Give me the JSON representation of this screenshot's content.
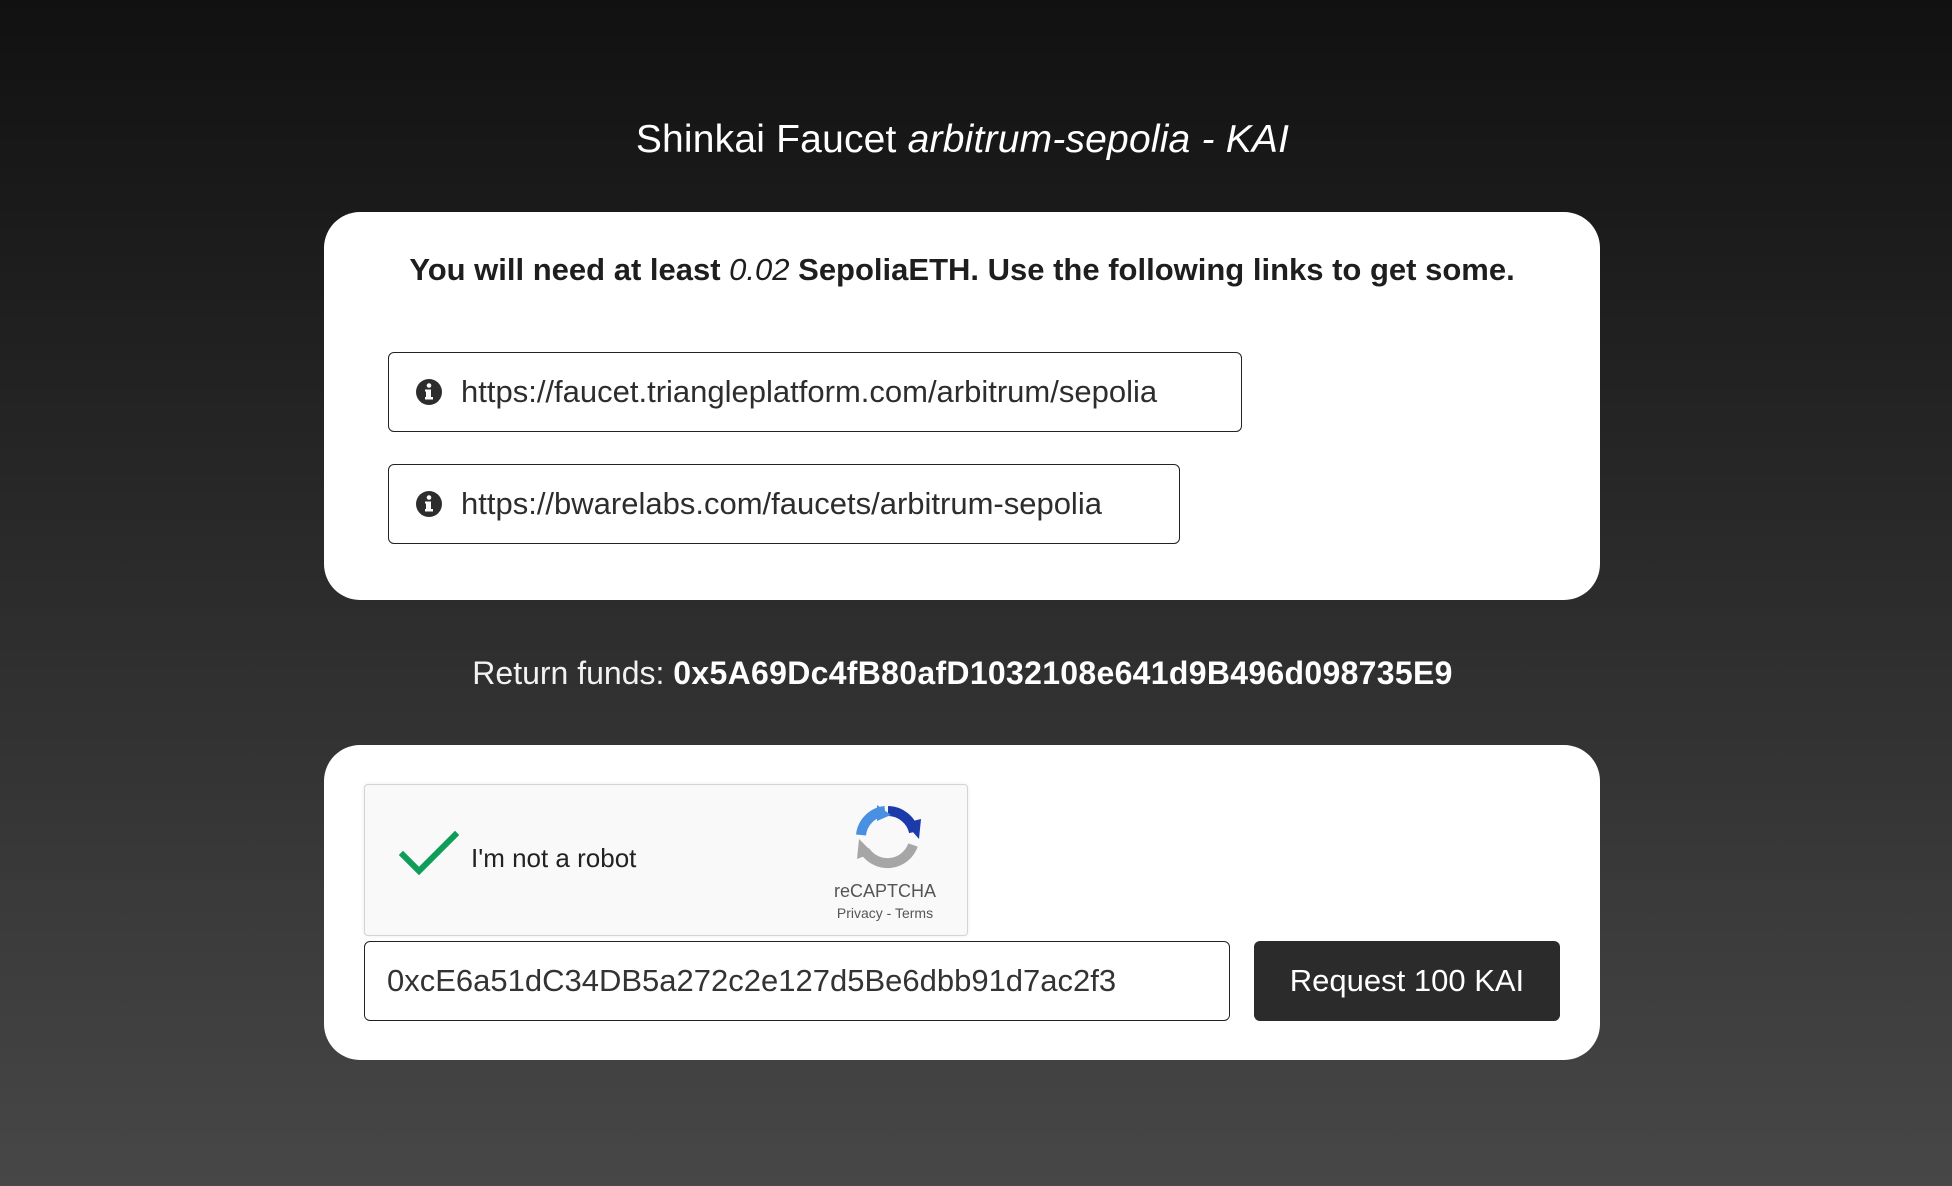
{
  "header": {
    "title_prefix": "Shinkai Faucet",
    "title_network": "arbitrum-sepolia - KAI"
  },
  "requirements": {
    "text_before": "You will need at least",
    "amount": "0.02",
    "text_after": "SepoliaETH. Use the following links to get some.",
    "links": [
      {
        "icon": "info-icon",
        "url": "https://faucet.triangleplatform.com/arbitrum/sepolia"
      },
      {
        "icon": "info-icon",
        "url": "https://bwarelabs.com/faucets/arbitrum-sepolia"
      }
    ]
  },
  "return_funds": {
    "label": "Return funds:",
    "address": "0x5A69Dc4fB80afD1032108e641d9B496d098735E9"
  },
  "captcha": {
    "label": "I'm not a robot",
    "checked": true,
    "brand": "reCAPTCHA",
    "privacy": "Privacy",
    "separator": " - ",
    "terms": "Terms"
  },
  "request": {
    "address_value": "0xcE6a51dC34DB5a272c2e127d5Be6dbb91d7ac2f3",
    "button_label": "Request 100 KAI"
  },
  "colors": {
    "check_green": "#0f9d58",
    "button_bg": "#2b2b2b",
    "recaptcha_blue": "#1c3aa9",
    "recaptcha_grey": "#a6a6a6"
  }
}
